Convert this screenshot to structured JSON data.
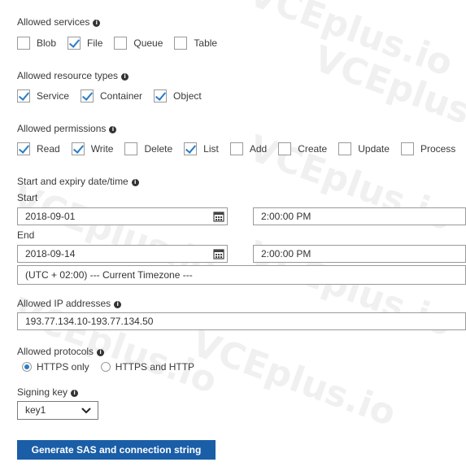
{
  "watermark": "VCEplus.io",
  "services": {
    "label": "Allowed services",
    "items": [
      {
        "label": "Blob",
        "checked": false
      },
      {
        "label": "File",
        "checked": true
      },
      {
        "label": "Queue",
        "checked": false
      },
      {
        "label": "Table",
        "checked": false
      }
    ]
  },
  "resource_types": {
    "label": "Allowed resource types",
    "items": [
      {
        "label": "Service",
        "checked": true
      },
      {
        "label": "Container",
        "checked": true
      },
      {
        "label": "Object",
        "checked": true
      }
    ]
  },
  "permissions": {
    "label": "Allowed permissions",
    "items": [
      {
        "label": "Read",
        "checked": true
      },
      {
        "label": "Write",
        "checked": true
      },
      {
        "label": "Delete",
        "checked": false
      },
      {
        "label": "List",
        "checked": true
      },
      {
        "label": "Add",
        "checked": false
      },
      {
        "label": "Create",
        "checked": false
      },
      {
        "label": "Update",
        "checked": false
      },
      {
        "label": "Process",
        "checked": false
      }
    ]
  },
  "datetime": {
    "label": "Start and expiry date/time",
    "start_label": "Start",
    "start_date": "2018-09-01",
    "start_time": "2:00:00 PM",
    "end_label": "End",
    "end_date": "2018-09-14",
    "end_time": "2:00:00 PM",
    "timezone": "(UTC + 02:00) --- Current Timezone ---"
  },
  "ip": {
    "label": "Allowed IP addresses",
    "value": "193.77.134.10-193.77.134.50"
  },
  "protocols": {
    "label": "Allowed protocols",
    "options": [
      {
        "label": "HTTPS only",
        "selected": true
      },
      {
        "label": "HTTPS and HTTP",
        "selected": false
      }
    ]
  },
  "signing_key": {
    "label": "Signing key",
    "value": "key1"
  },
  "generate_button": "Generate SAS and connection string",
  "accent_color": "#2a7bc4",
  "button_color": "#1a5ea8"
}
